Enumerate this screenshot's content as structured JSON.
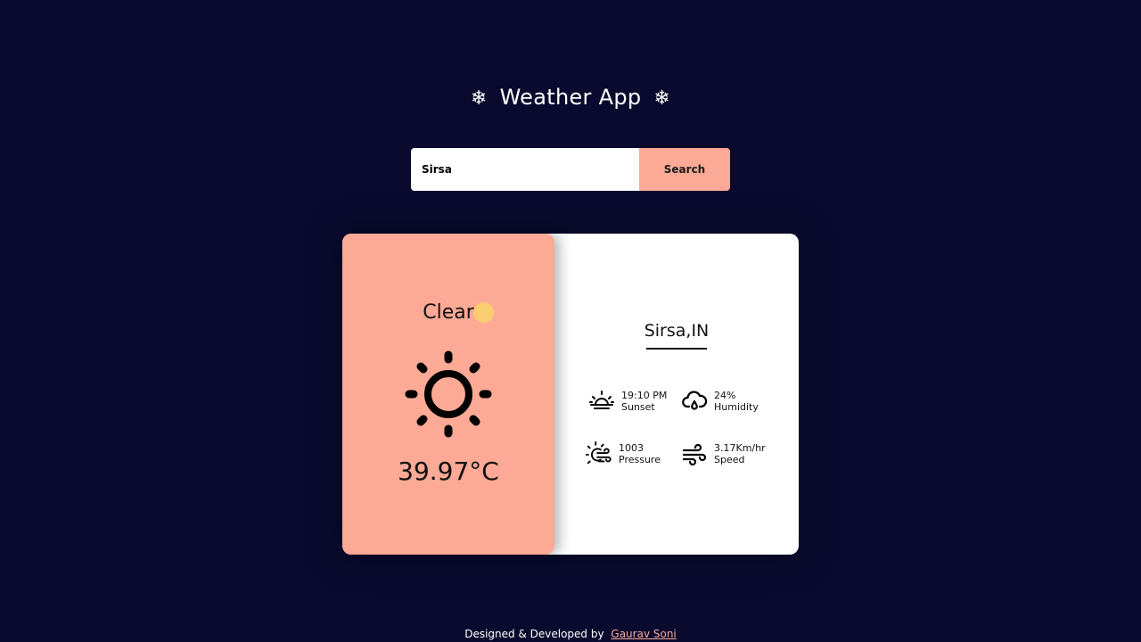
{
  "header": {
    "title": "Weather App",
    "left_icon": "snowflake-icon",
    "right_icon": "snowflake-icon",
    "flake_glyph": "❄"
  },
  "search": {
    "value": "Sirsa",
    "placeholder": "",
    "button_label": "Search"
  },
  "weather": {
    "condition": "Clear",
    "condition_icon": "sun-icon",
    "temperature": "39.97°C",
    "city": "Sirsa,IN",
    "stats": {
      "sunset": {
        "value": "19:10 PM",
        "label": "Sunset",
        "icon": "sunset-icon"
      },
      "humidity": {
        "value": "24%",
        "label": "Humidity",
        "icon": "humidity-icon"
      },
      "pressure": {
        "value": "1003",
        "label": "Pressure",
        "icon": "pressure-icon"
      },
      "speed": {
        "value": "3.17Km/hr",
        "label": "Speed",
        "icon": "wind-icon"
      }
    }
  },
  "footer": {
    "text": "Designed & Developed by",
    "author": "Gaurav Soni"
  },
  "colors": {
    "background": "#0a0a2e",
    "accent": "#fca996",
    "card": "#ffffff"
  }
}
